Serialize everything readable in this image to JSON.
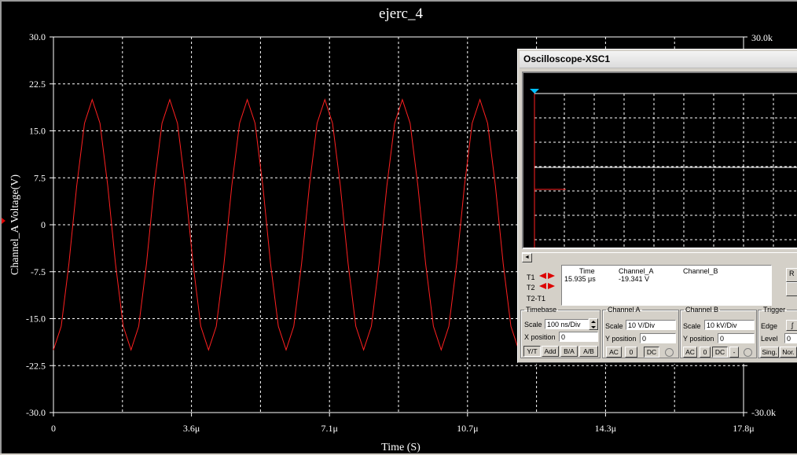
{
  "grapher": {
    "title": "ejerc_4",
    "y_axis_label": "Channel_A Voltage(V)",
    "x_axis_label": "Time (S)",
    "right_axis_ticks": [
      "30.0k",
      "-30.0k"
    ],
    "marker_color": "#e00000",
    "trace_color": "#ff2020"
  },
  "chart_data": {
    "type": "line",
    "title": "ejerc_4",
    "xlabel": "Time (S)",
    "ylabel": "Channel_A Voltage(V)",
    "x_ticks": [
      "0",
      "3.6μ",
      "7.1μ",
      "10.7μ",
      "14.3μ",
      "17.8μ"
    ],
    "y_ticks": [
      "30.0",
      "22.5",
      "15.0",
      "7.5",
      "0",
      "-7.5",
      "-15.0",
      "-22.5",
      "-30.0"
    ],
    "xlim": [
      0,
      17.8
    ],
    "ylim": [
      -30,
      30
    ],
    "x_unit": "μs",
    "grid": true,
    "series": [
      {
        "color": "#ff2020",
        "x": [
          0,
          0.2,
          0.4,
          0.6,
          0.8,
          1.0,
          1.2,
          1.4,
          1.6,
          1.8,
          2.0,
          2.2,
          2.4,
          2.6,
          2.8,
          3.0,
          3.2,
          3.4,
          3.6,
          3.8,
          4.0,
          4.2,
          4.4,
          4.6,
          4.8,
          5.0,
          5.2,
          5.4,
          5.6,
          5.8,
          6.0,
          6.2,
          6.4,
          6.6,
          6.8,
          7.0,
          7.2,
          7.4,
          7.6,
          7.8,
          8.0,
          8.2,
          8.4,
          8.6,
          8.8,
          9.0,
          9.2,
          9.4,
          9.6,
          9.8,
          10.0,
          10.2,
          10.4,
          10.6,
          10.8,
          11.0,
          11.2,
          11.4,
          11.6,
          11.8,
          12.0
        ],
        "y": [
          -20.0,
          -16.2,
          -6.2,
          6.2,
          16.2,
          20.0,
          16.2,
          6.2,
          -6.2,
          -16.2,
          -20.0,
          -16.2,
          -6.2,
          6.2,
          16.2,
          20.0,
          16.2,
          6.2,
          -6.2,
          -16.2,
          -20.0,
          -16.2,
          -6.2,
          6.2,
          16.2,
          20.0,
          16.2,
          6.2,
          -6.2,
          -16.2,
          -20.0,
          -16.2,
          -6.2,
          6.2,
          16.2,
          20.0,
          16.2,
          6.2,
          -6.2,
          -16.2,
          -20.0,
          -16.2,
          -6.2,
          6.2,
          16.2,
          20.0,
          16.2,
          6.2,
          -6.2,
          -16.2,
          -20.0,
          -16.2,
          -6.2,
          6.2,
          16.2,
          20.0,
          16.2,
          6.2,
          -6.2,
          -16.2,
          -20.0
        ]
      }
    ]
  },
  "oscilloscope": {
    "window_title": "Oscilloscope-XSC1",
    "screen": {
      "trace_a_color": "#ff2020",
      "trace_b_color": "#ffffff",
      "cursor_color": "#00c0ff"
    },
    "cursors": {
      "col_time": "Time",
      "col_a": "Channel_A",
      "col_b": "Channel_B",
      "t1_label": "T1",
      "t2_label": "T2",
      "diff_label": "T2-T1",
      "t1_time": "15.935 μs",
      "t1_a": "-19.341 V"
    },
    "side_buttons": [
      "R",
      ""
    ],
    "timebase": {
      "legend": "Timebase",
      "scale_label": "Scale",
      "scale_value": "100 ns/Div",
      "xpos_label": "X position",
      "xpos_value": "0",
      "buttons": [
        "Y/T",
        "Add",
        "B/A",
        "A/B"
      ]
    },
    "channel_a": {
      "legend": "Channel A",
      "scale_label": "Scale",
      "scale_value": "10  V/Div",
      "ypos_label": "Y position",
      "ypos_value": "0",
      "buttons": [
        "AC",
        "0",
        "DC"
      ]
    },
    "channel_b": {
      "legend": "Channel B",
      "scale_label": "Scale",
      "scale_value": "10 kV/Div",
      "ypos_label": "Y position",
      "ypos_value": "0",
      "buttons": [
        "AC",
        "0",
        "DC",
        "-"
      ]
    },
    "trigger": {
      "legend": "Trigger",
      "edge_label": "Edge",
      "level_label": "Level",
      "level_value": "0",
      "buttons": [
        "Sing.",
        "Nor."
      ]
    }
  }
}
